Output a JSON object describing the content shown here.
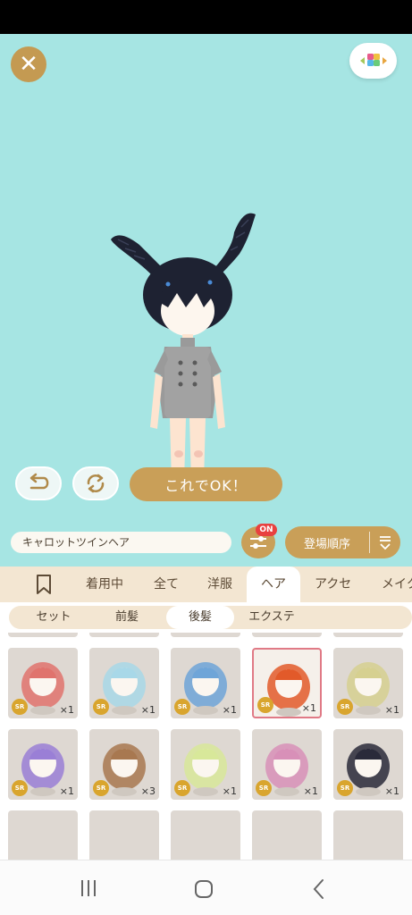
{
  "ok_button": "これでOK！",
  "item_name": "キャロットツインヘア",
  "filter_badge": "ON",
  "sort_label": "登場順序",
  "tabs": [
    "着用中",
    "全て",
    "洋服",
    "ヘア",
    "アクセ",
    "メイク"
  ],
  "subtabs": [
    "セット",
    "前髪",
    "後髪",
    "エクステ"
  ],
  "items": [
    {
      "rarity": "SR",
      "qty": "×1",
      "hair": "#e0736d"
    },
    {
      "rarity": "SR",
      "qty": "×1",
      "hair": "#a8d8e8"
    },
    {
      "rarity": "SR",
      "qty": "×1",
      "hair": "#6fa5d8"
    },
    {
      "rarity": "SR",
      "qty": "×1",
      "hair": "#e25a2a"
    },
    {
      "rarity": "SR",
      "qty": "×1",
      "hair": "#d6d090"
    },
    {
      "rarity": "SR",
      "qty": "×1",
      "hair": "#9a7fd6"
    },
    {
      "rarity": "SR",
      "qty": "×3",
      "hair": "#a87850"
    },
    {
      "rarity": "SR",
      "qty": "×1",
      "hair": "#d8e89a"
    },
    {
      "rarity": "SR",
      "qty": "×1",
      "hair": "#d890b8"
    },
    {
      "rarity": "SR",
      "qty": "×1",
      "hair": "#2a2a3a"
    }
  ],
  "colors": {
    "stage_bg": "#a6e5e3",
    "gold": "#c99f58",
    "tab_bg": "#f3e6d2",
    "badge_red": "#e8413f",
    "selected_border": "#e07a86"
  }
}
